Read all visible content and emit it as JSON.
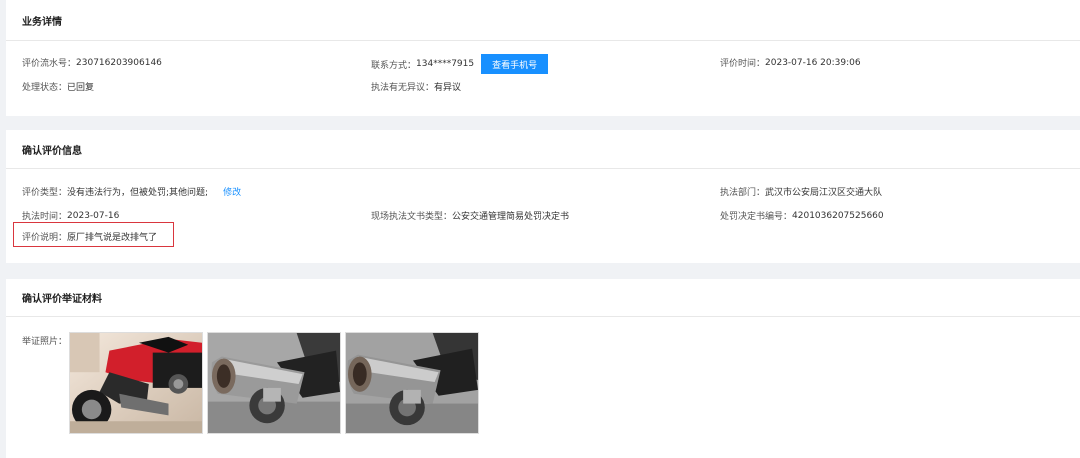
{
  "business": {
    "title": "业务详情",
    "serial": {
      "label": "评价流水号：",
      "value": "230716203906146"
    },
    "contact": {
      "label": "联系方式：",
      "value": "134****7915",
      "button": "查看手机号"
    },
    "eval_time": {
      "label": "评价时间：",
      "value": "2023-07-16 20:39:06"
    },
    "status": {
      "label": "处理状态：",
      "value": "已回复"
    },
    "objection": {
      "label": "执法有无异议：",
      "value": "有异议"
    }
  },
  "confirm": {
    "title": "确认评价信息",
    "type": {
      "label": "评价类型：",
      "value": "没有违法行为，但被处罚;其他问题;",
      "edit": "修改"
    },
    "dept": {
      "label": "执法部门：",
      "value": "武汉市公安局江汉区交通大队"
    },
    "enforce_time": {
      "label": "执法时间：",
      "value": "2023-07-16"
    },
    "doc_type": {
      "label": "现场执法文书类型：",
      "value": "公安交通管理简易处罚决定书"
    },
    "decision_no": {
      "label": "处罚决定书编号：",
      "value": "4201036207525660"
    },
    "desc": {
      "label": "评价说明：",
      "value": "原厂排气说是改排气了"
    }
  },
  "evidence": {
    "title": "确认评价举证材料",
    "photos_label": "举证照片：",
    "photos": [
      "motorcycle-photo",
      "exhaust-photo",
      "exhaust-photo"
    ]
  },
  "colors": {
    "primary": "#1890ff",
    "highlight": "#d9363e"
  }
}
